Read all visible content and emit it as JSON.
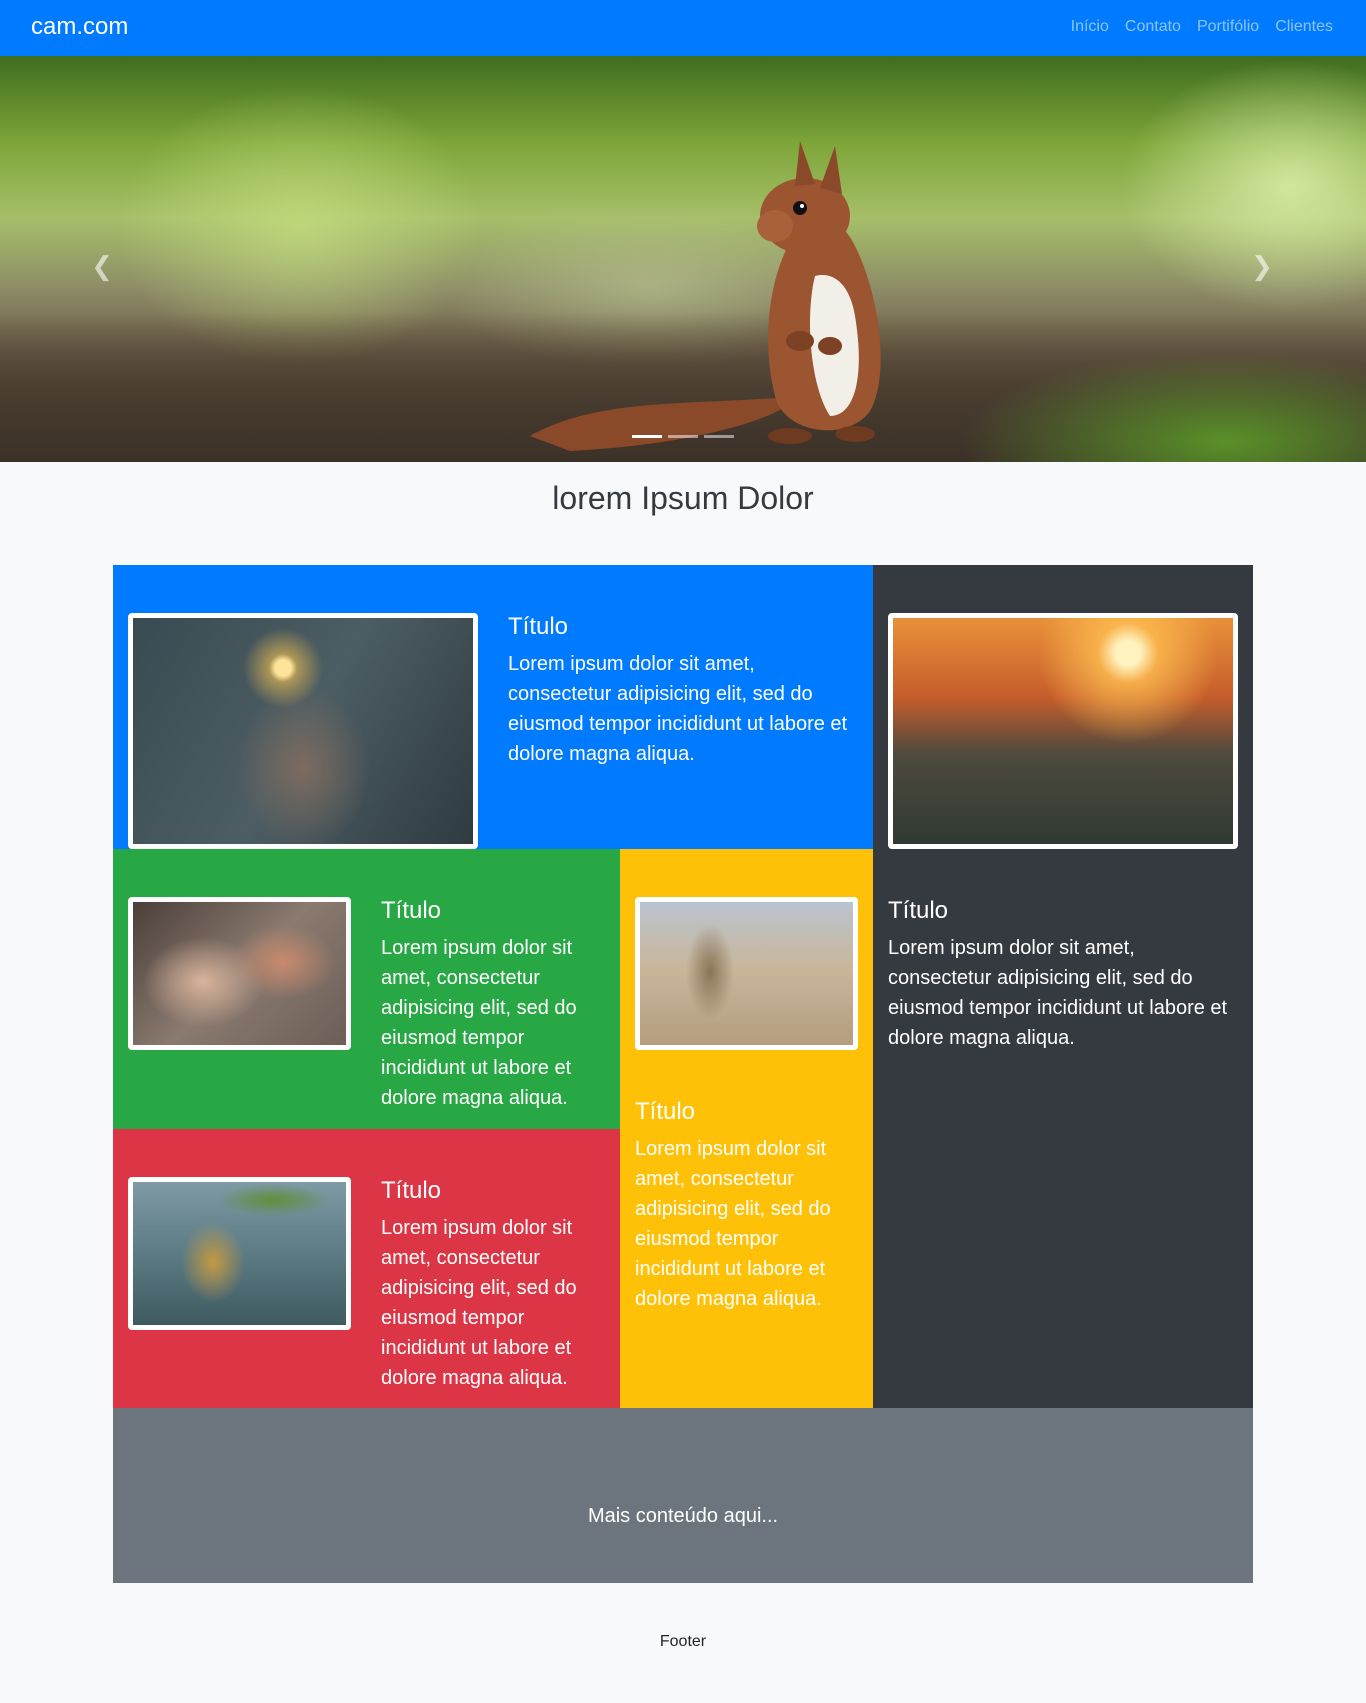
{
  "navbar": {
    "brand": "cam.com",
    "links": [
      "Início",
      "Contato",
      "Portifólio",
      "Clientes"
    ]
  },
  "carousel": {
    "prev_icon": "chevron-left-icon",
    "next_icon": "chevron-right-icon",
    "indicators": 3,
    "active_indicator": 0
  },
  "page_title": "lorem Ipsum Dolor",
  "cards": [
    {
      "title": "Título",
      "text": "Lorem ipsum dolor sit amet, consectetur adipisicing elit, sed do eiusmod tempor incididunt ut labore et dolore magna aliqua."
    },
    {
      "title": "Título",
      "text": "Lorem ipsum dolor sit amet, consectetur adipisicing elit, sed do eiusmod tempor incididunt ut labore et dolore magna aliqua."
    },
    {
      "title": "Título",
      "text": "Lorem ipsum dolor sit amet, consectetur adipisicing elit, sed do eiusmod tempor incididunt ut labore et dolore magna aliqua."
    },
    {
      "title": "Título",
      "text": "Lorem ipsum dolor sit amet, consectetur adipisicing elit, sed do eiusmod tempor incididunt ut labore et dolore magna aliqua."
    },
    {
      "title": "Título",
      "text": "Lorem ipsum dolor sit amet, consectetur adipisicing elit, sed do eiusmod tempor incididunt ut labore et dolore magna aliqua."
    }
  ],
  "more_content": "Mais conteúdo aqui...",
  "footer": "Footer",
  "colors": {
    "primary": "#007bff",
    "success": "#28a745",
    "danger": "#dc3545",
    "warning": "#ffc107",
    "dark": "#343a40",
    "secondary": "#6c757d",
    "light": "#f8f9fa"
  }
}
